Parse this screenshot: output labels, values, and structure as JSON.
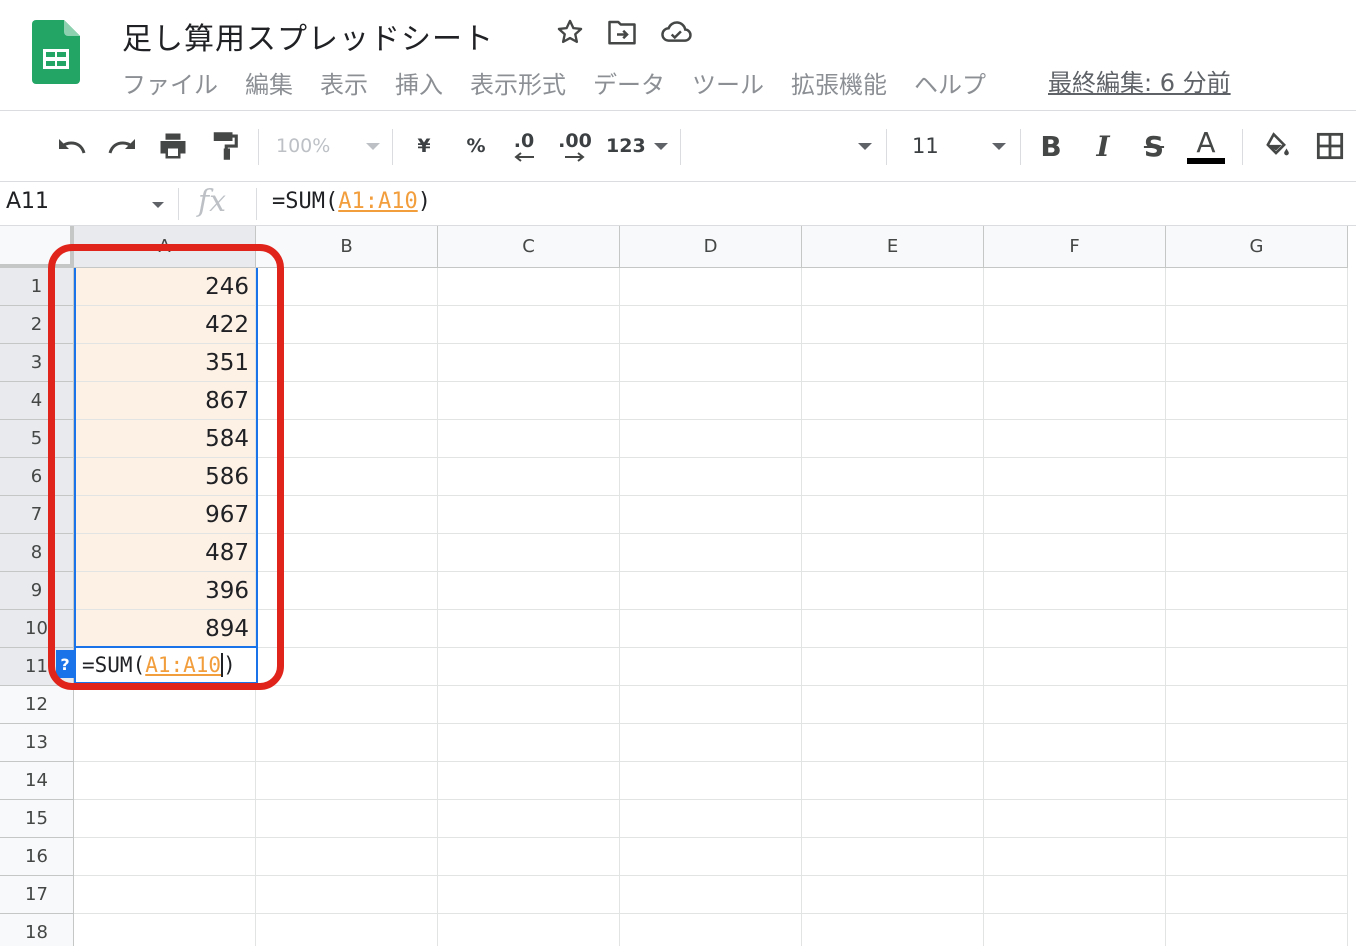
{
  "header": {
    "title": "足し算用スプレッドシート",
    "menu": [
      "ファイル",
      "編集",
      "表示",
      "挿入",
      "表示形式",
      "データ",
      "ツール",
      "拡張機能",
      "ヘルプ"
    ],
    "last_edit": "最終編集: 6 分前"
  },
  "toolbar": {
    "zoom": "100%",
    "currency": "¥",
    "percent": "%",
    "decrease_decimal": ".0",
    "increase_decimal": ".00",
    "number_format": "123",
    "font_size": "11",
    "bold": "B",
    "italic": "I",
    "strike": "S",
    "text_color": "A"
  },
  "formula_bar": {
    "cell_ref": "A11",
    "fx": "fx",
    "prefix": "=SUM(",
    "range": "A1:A10",
    "suffix": ")"
  },
  "grid": {
    "columns": [
      "A",
      "B",
      "C",
      "D",
      "E",
      "F",
      "G"
    ],
    "rows": [
      "1",
      "2",
      "3",
      "4",
      "5",
      "6",
      "7",
      "8",
      "9",
      "10",
      "11",
      "12",
      "13",
      "14",
      "15",
      "16",
      "17",
      "18"
    ],
    "column_a_values": [
      "246",
      "422",
      "351",
      "867",
      "584",
      "586",
      "967",
      "487",
      "396",
      "894"
    ],
    "active_cell": {
      "help": "?",
      "prefix": "=SUM(",
      "range": "A1:A10",
      "suffix": ")"
    }
  },
  "colors": {
    "highlight": "#fdf1e6",
    "selection": "#1a73e8",
    "annotation": "#e0241b",
    "range_ref": "#f29e3d",
    "logo": "#23a566"
  }
}
